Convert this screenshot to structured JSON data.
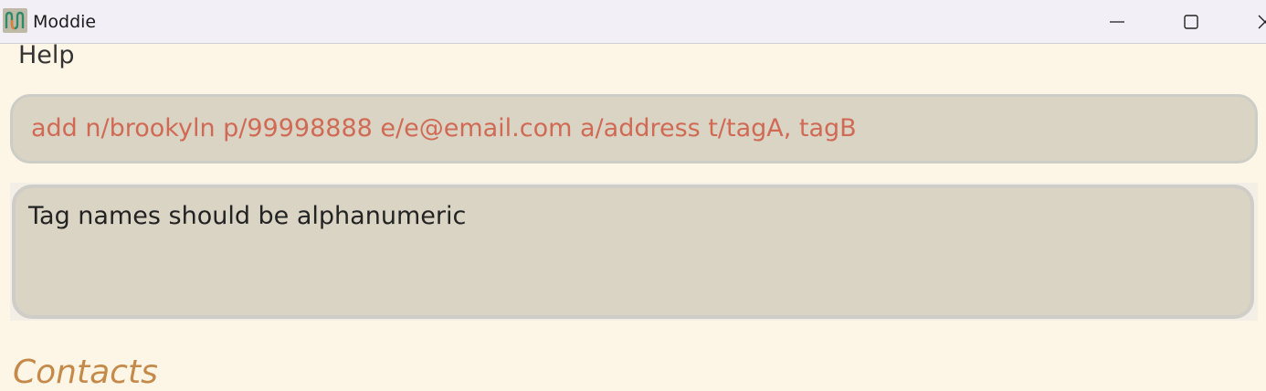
{
  "window": {
    "title": "Moddie",
    "icon": "moddie-logo-icon",
    "controls": [
      "minimize-icon",
      "maximize-icon",
      "close-icon"
    ]
  },
  "menu": {
    "help_label": "Help"
  },
  "command_box": {
    "value": "add n/brookyln p/99998888 e/e@email.com a/address t/tagA, tagB",
    "text_color": "#d06a55"
  },
  "result_display": {
    "message": "Tag names should be alphanumeric"
  },
  "section": {
    "heading": "Contacts"
  },
  "colors": {
    "background": "#fdf6e6",
    "box_fill": "#dad4c4",
    "heading_accent": "#c58a4a"
  }
}
